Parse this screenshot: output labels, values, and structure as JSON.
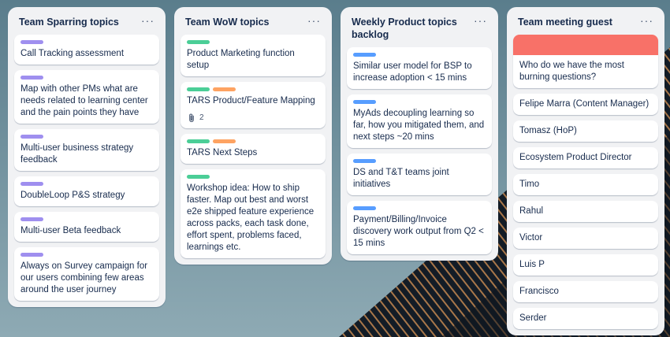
{
  "colors": {
    "purple_label": "#9f8fef",
    "green_label": "#4bce97",
    "orange_label": "#fea362",
    "blue_label": "#579dff",
    "cover_red": "#f87168"
  },
  "menu_glyph": "···",
  "lists": [
    {
      "title": "Team Sparring topics",
      "cards": [
        {
          "labels": [
            "purple"
          ],
          "text": "Call Tracking assessment"
        },
        {
          "labels": [
            "purple"
          ],
          "text": "Map with other PMs what are needs related to learning center and the pain points they have"
        },
        {
          "labels": [
            "purple"
          ],
          "text": "Multi-user business strategy feedback"
        },
        {
          "labels": [
            "purple"
          ],
          "text": "DoubleLoop P&S strategy"
        },
        {
          "labels": [
            "purple"
          ],
          "text": "Multi-user Beta feedback"
        },
        {
          "labels": [
            "purple"
          ],
          "text": "Always on Survey campaign for our users combining few areas around the user journey"
        }
      ]
    },
    {
      "title": "Team WoW topics",
      "cards": [
        {
          "labels": [
            "green"
          ],
          "text": "Product Marketing function setup"
        },
        {
          "labels": [
            "green",
            "orange"
          ],
          "text": "TARS Product/Feature Mapping",
          "attachments": "2"
        },
        {
          "labels": [
            "green",
            "orange"
          ],
          "text": "TARS Next Steps"
        },
        {
          "labels": [
            "green"
          ],
          "text": "Workshop idea: How to ship faster. Map out best and worst e2e shipped feature experience across packs, each task done, effort spent, problems faced, learnings etc."
        }
      ]
    },
    {
      "title": "Weekly Product topics backlog",
      "cards": [
        {
          "labels": [
            "blue"
          ],
          "text": "Similar user model for BSP to increase adoption < 15 mins"
        },
        {
          "labels": [
            "blue"
          ],
          "text": "MyAds decoupling learning so far, how you mitigated them, and next steps ~20 mins"
        },
        {
          "labels": [
            "blue"
          ],
          "text": "DS and T&T teams joint initiatives"
        },
        {
          "labels": [
            "blue"
          ],
          "text": "Payment/Billing/Invoice discovery work output from Q2 < 15 mins"
        }
      ]
    },
    {
      "title": "Team meeting guest",
      "cards": [
        {
          "labels": [],
          "cover": true,
          "text": "Who do we have the most burning questions?"
        },
        {
          "labels": [],
          "text": "Felipe Marra (Content Manager)"
        },
        {
          "labels": [],
          "text": "Tomasz (HoP)"
        },
        {
          "labels": [],
          "text": "Ecosystem Product Director"
        },
        {
          "labels": [],
          "text": "Timo"
        },
        {
          "labels": [],
          "text": "Rahul"
        },
        {
          "labels": [],
          "text": "Victor"
        },
        {
          "labels": [],
          "text": "Luis P"
        },
        {
          "labels": [],
          "text": "Francisco"
        },
        {
          "labels": [],
          "text": "Serder"
        }
      ]
    }
  ]
}
